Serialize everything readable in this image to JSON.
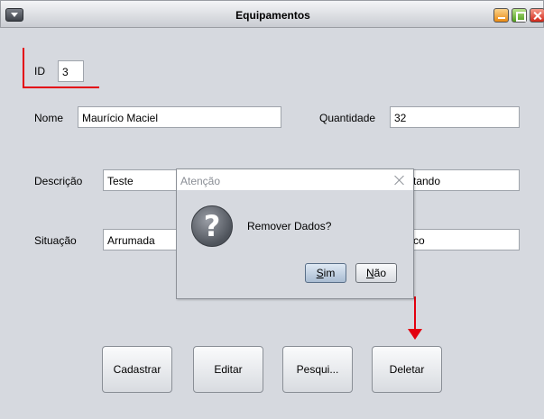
{
  "window": {
    "title": "Equipamentos"
  },
  "form": {
    "id_label": "ID",
    "id_value": "3",
    "nome_label": "Nome",
    "nome_value": "Maurício Maciel",
    "quantidade_label": "Quantidade",
    "quantidade_value": "32",
    "descricao_label": "Descrição",
    "descricao_value": "Teste",
    "status_visible": "tando",
    "situacao_label": "Situação",
    "situacao_value": "Arrumada",
    "local_visible": "co"
  },
  "buttons": {
    "cadastrar": "Cadastrar",
    "editar": "Editar",
    "pesquisar": "Pesqui...",
    "deletar": "Deletar"
  },
  "dialog": {
    "title": "Atenção",
    "message": "Remover Dados?",
    "yes_mnemonic": "S",
    "yes_rest": "im",
    "no_mnemonic": "N",
    "no_rest": "ão",
    "icon": "question-icon"
  },
  "colors": {
    "annotation": "#e3000f",
    "background": "#d6d9df"
  }
}
